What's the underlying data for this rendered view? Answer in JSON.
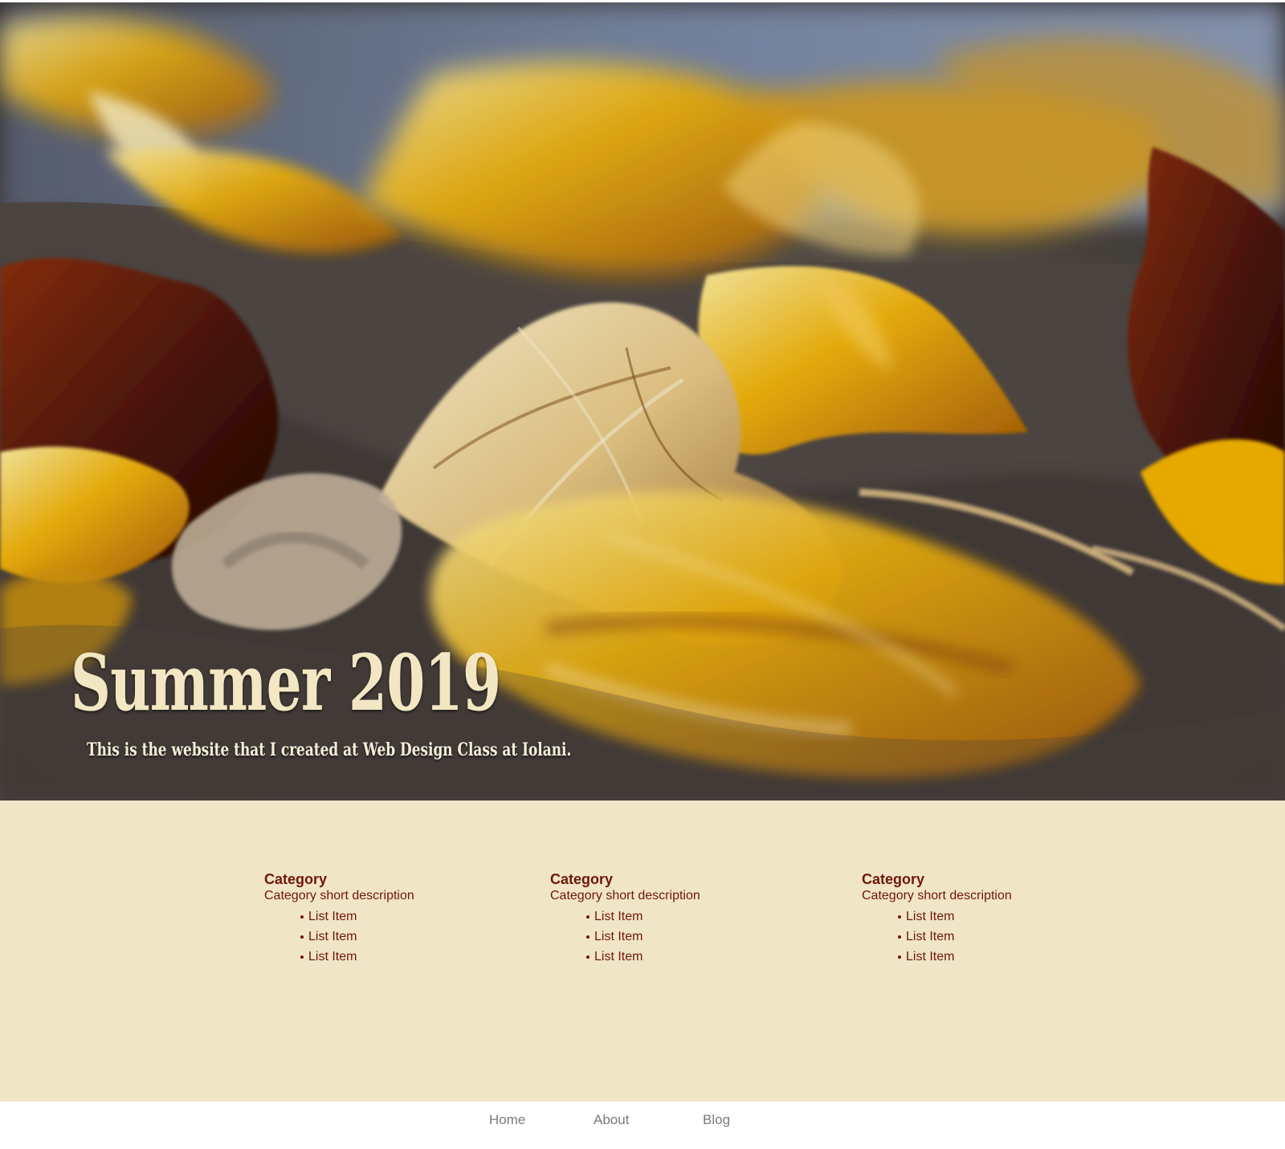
{
  "hero": {
    "title": "Summer 2019",
    "subtitle": "This is the website that I created at Web Design Class at Iolani."
  },
  "categories": [
    {
      "title": "Category",
      "description": "Category short description",
      "items": [
        "List Item",
        "List Item",
        "List Item"
      ]
    },
    {
      "title": "Category",
      "description": "Category short description",
      "items": [
        "List Item",
        "List Item",
        "List Item"
      ]
    },
    {
      "title": "Category",
      "description": "Category short description",
      "items": [
        "List Item",
        "List Item",
        "List Item"
      ]
    }
  ],
  "nav": {
    "home": "Home",
    "about": "About",
    "blog": "Blog"
  },
  "colors": {
    "content_background": "#f1e5c8",
    "category_text": "#6f1709",
    "hero_title": "#f3e7c3",
    "navigation_text": "#7a7a7a"
  }
}
